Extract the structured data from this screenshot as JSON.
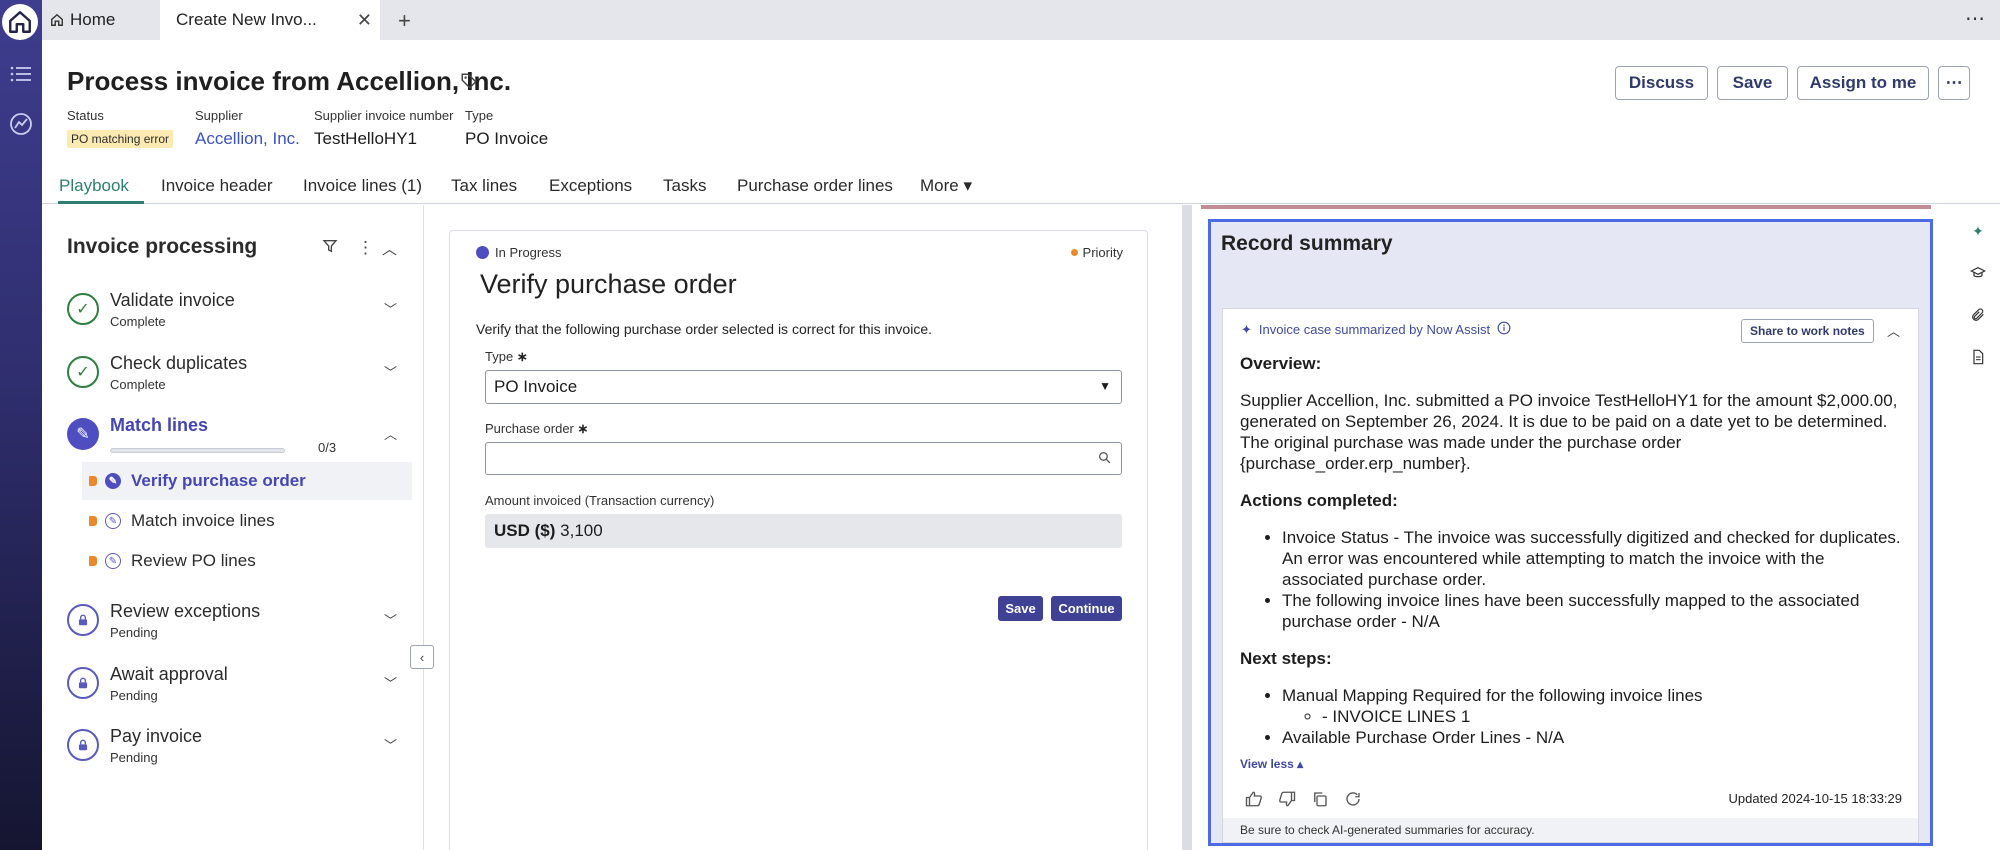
{
  "tabs": {
    "home_label": "Home",
    "active_label": "Create New Invo...",
    "close_glyph": "✕",
    "add_glyph": "+",
    "more_glyph": "⋯"
  },
  "header": {
    "title": "Process invoice from Accellion, Inc.",
    "meta": [
      {
        "label": "Status",
        "value": "PO matching error"
      },
      {
        "label": "Supplier",
        "value": "Accellion, Inc."
      },
      {
        "label": "Supplier invoice number",
        "value": "TestHelloHY1"
      },
      {
        "label": "Type",
        "value": "PO Invoice"
      }
    ],
    "buttons": {
      "discuss": "Discuss",
      "save": "Save",
      "assign": "Assign to me",
      "more": "⋯"
    }
  },
  "nav_tabs": [
    "Playbook",
    "Invoice header",
    "Invoice lines (1)",
    "Tax lines",
    "Exceptions",
    "Tasks",
    "Purchase order lines",
    "More ▾"
  ],
  "playbook": {
    "title": "Invoice processing",
    "steps": [
      {
        "name": "Validate invoice",
        "status": "Complete"
      },
      {
        "name": "Check duplicates",
        "status": "Complete"
      },
      {
        "name": "Match lines",
        "progress_text": "0/3",
        "progress": 0
      },
      {
        "name": "Review exceptions",
        "status": "Pending"
      },
      {
        "name": "Await approval",
        "status": "Pending"
      },
      {
        "name": "Pay invoice",
        "status": "Pending"
      }
    ],
    "sub_items": [
      "Verify purchase order",
      "Match invoice lines",
      "Review PO lines"
    ]
  },
  "task": {
    "status": "In Progress",
    "priority": "Priority",
    "title": "Verify purchase order",
    "description": "Verify that the following purchase order selected is correct for this invoice.",
    "type_label": "Type",
    "type_value": "PO Invoice",
    "po_label": "Purchase order",
    "amount_label": "Amount invoiced (Transaction currency)",
    "amount_currency": "USD ($)",
    "amount_value": "3,100",
    "required_glyph": "∗",
    "save": "Save",
    "continue": "Continue"
  },
  "summary": {
    "title": "Record summary",
    "ai_heading": "Invoice case summarized by Now Assist",
    "share": "Share to work notes",
    "overview_heading": "Overview:",
    "overview_text": "Supplier Accellion, Inc. submitted a PO invoice TestHelloHY1 for the amount $2,000.00, generated on September 26, 2024. It is due to be paid on a date yet to be determined. The original purchase was made under the purchase order {purchase_order.erp_number}.",
    "actions_heading": "Actions completed:",
    "actions": [
      "Invoice Status - The invoice was successfully digitized and checked for duplicates. An error was encountered while attempting to match the invoice with the associated purchase order.",
      "The following invoice lines have been successfully mapped to the associated purchase order - N/A"
    ],
    "next_heading": "Next steps:",
    "next_steps": [
      "Manual Mapping Required for the following invoice lines",
      "Available Purchase Order Lines - N/A"
    ],
    "next_sub": "- INVOICE LINES 1",
    "view_less": "View less ▴",
    "updated": "Updated 2024-10-15 18:33:29",
    "disclaimer": "Be sure to check AI-generated summaries for accuracy."
  },
  "colors": {
    "accent": "#4e4ec0",
    "playbook_green": "#2e7f6f",
    "rail": "#3e3d8f",
    "highlight_border": "#4d6ce3"
  }
}
